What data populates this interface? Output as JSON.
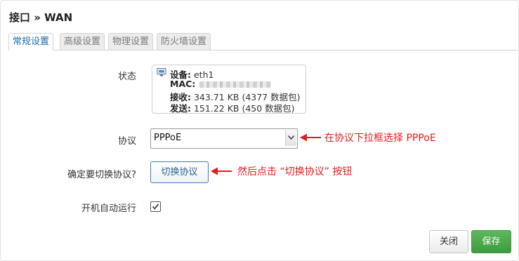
{
  "dialog": {
    "title": "接口 » WAN"
  },
  "tabs": [
    {
      "label": "常规设置",
      "active": true
    },
    {
      "label": "高级设置",
      "active": false
    },
    {
      "label": "物理设置",
      "active": false
    },
    {
      "label": "防火墙设置",
      "active": false
    }
  ],
  "status": {
    "label": "状态",
    "device_key": "设备:",
    "device_value": "eth1",
    "mac_key": "MAC:",
    "rx_key": "接收:",
    "rx_value": "343.71 KB (4377 数据包)",
    "tx_key": "发送:",
    "tx_value": "151.22 KB (450 数据包)"
  },
  "protocol": {
    "label": "协议",
    "selected": "PPPoE"
  },
  "switch_protocol": {
    "label": "确定要切换协议?",
    "button_label": "切换协议"
  },
  "autostart": {
    "label": "开机自动运行",
    "checked": true
  },
  "annotations": {
    "protocol_hint": "在协议下拉框选择 PPPoE",
    "switch_hint": "然后点击 “切换协议” 按钮",
    "color": "#e41a1a"
  },
  "footer": {
    "close_label": "关闭",
    "save_label": "保存"
  }
}
